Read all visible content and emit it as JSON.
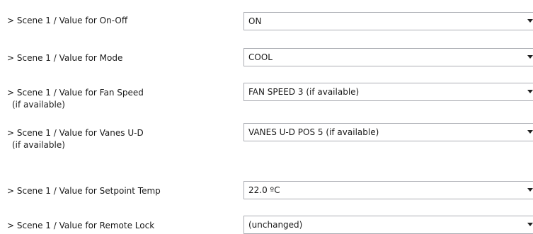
{
  "parameters": [
    {
      "label": "> Scene 1 / Value for On-Off",
      "sublabel": "",
      "value": "ON",
      "arrow_icon": "chevron-down-icon"
    },
    {
      "label": "> Scene 1 / Value for Mode",
      "sublabel": "",
      "value": "COOL",
      "arrow_icon": "chevron-down-icon"
    },
    {
      "label": "> Scene 1 / Value for Fan Speed",
      "sublabel": "(if available)",
      "value": "FAN SPEED 3 (if available)",
      "arrow_icon": "chevron-down-icon"
    },
    {
      "label": "> Scene 1 / Value for Vanes U-D",
      "sublabel": "(if available)",
      "value": "VANES U-D POS 5 (if available)",
      "arrow_icon": "chevron-down-icon"
    },
    {
      "label": "> Scene 1 / Value for Setpoint Temp",
      "sublabel": "",
      "value": "22.0 ºC",
      "arrow_icon": "chevron-down-icon"
    },
    {
      "label": "> Scene 1 / Value for Remote Lock",
      "sublabel": "",
      "value": "(unchanged)",
      "arrow_icon": "chevron-down-icon"
    }
  ]
}
